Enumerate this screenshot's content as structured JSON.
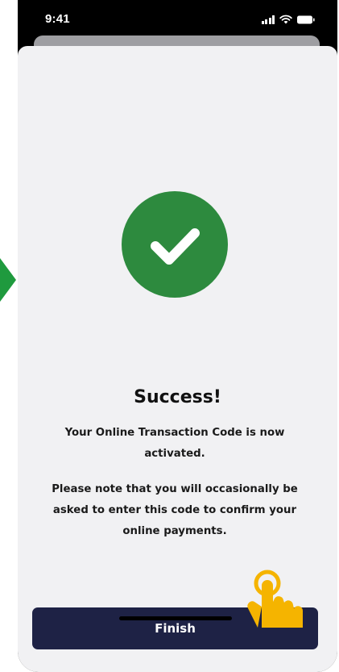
{
  "status_bar": {
    "time": "9:41",
    "icons": [
      "signal-icon",
      "wifi-icon",
      "battery-icon"
    ]
  },
  "result": {
    "icon": "checkmark-icon",
    "title": "Success!",
    "message_1": "Your Online Transaction Code is now activated.",
    "message_2": "Please note that you will occasionally be asked to enter this code to confirm your online payments."
  },
  "actions": {
    "finish_label": "Finish"
  },
  "annotations": {
    "tap_indicator_icon": "tap-hand-icon",
    "side_arrow_icon": "arrow-right-icon"
  },
  "colors": {
    "success_green": "#2d8a3e",
    "button_navy": "#1e2245",
    "tap_indicator": "#f5b400",
    "side_arrow": "#1f9a3e"
  }
}
